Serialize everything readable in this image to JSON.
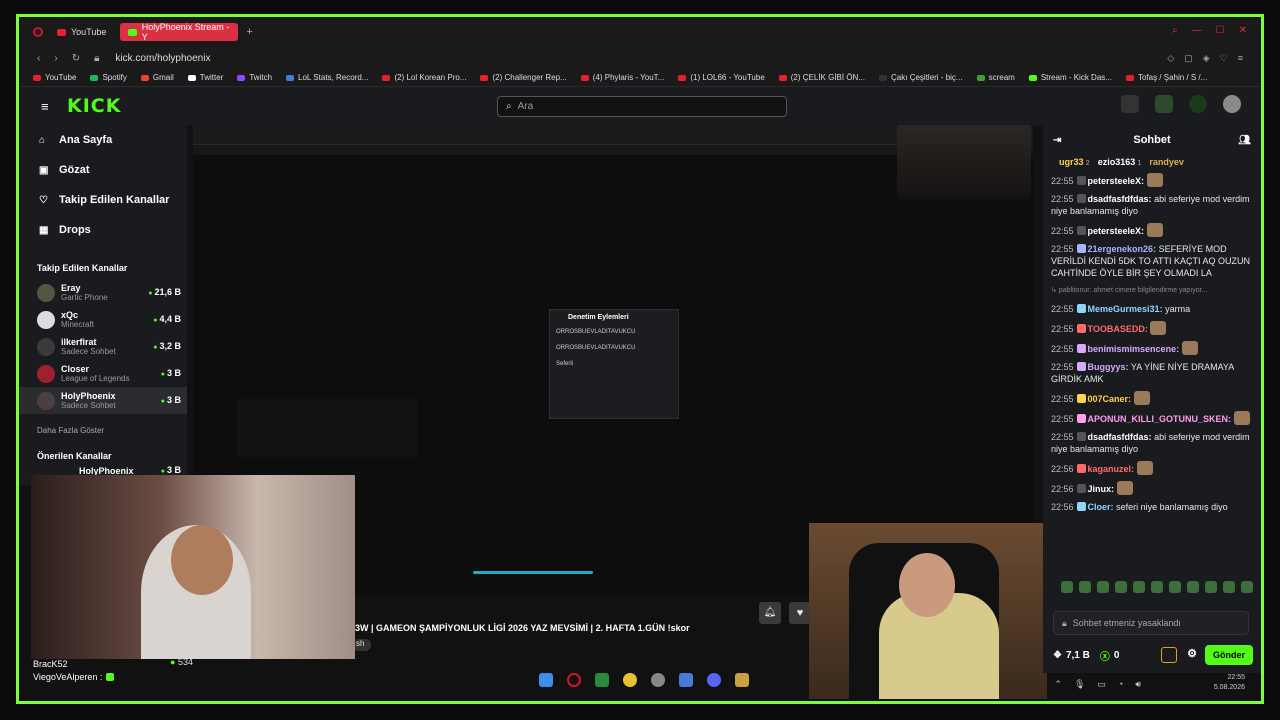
{
  "browser": {
    "tabs": [
      {
        "label": "YouTube"
      },
      {
        "label": "HolyPhoenix Stream - Y"
      }
    ],
    "url": "kick.com/holyphoenix",
    "bookmarks": [
      "YouTube",
      "Spotify",
      "Gmail",
      "Twitter",
      "Twitch",
      "LoL Stats, Record...",
      "(2) Lol Korean Pro...",
      "(2) Challenger Rep...",
      "(4) Phylaris - YouT...",
      "(1) LOL66 - YouTube",
      "(2) ÇELİK GİBİ ÖN...",
      "Çakı Çeşitleri - biç...",
      "scream",
      "Stream - Kick Das...",
      "Tofaş / Şahin / S /..."
    ]
  },
  "header": {
    "logo": "KICK",
    "search_placeholder": "Ara"
  },
  "sidebar": {
    "nav": [
      {
        "label": "Ana Sayfa",
        "icon": "home-icon"
      },
      {
        "label": "Gözat",
        "icon": "browse-icon"
      },
      {
        "label": "Takip Edilen Kanallar",
        "icon": "heart-icon"
      },
      {
        "label": "Drops",
        "icon": "drops-icon"
      }
    ],
    "followed_title": "Takip Edilen Kanallar",
    "channels": [
      {
        "name": "Eray",
        "game": "Gartic Phone",
        "viewers": "21,6 B"
      },
      {
        "name": "xQc",
        "game": "Minecraft",
        "viewers": "4,4 B"
      },
      {
        "name": "ilkerfirat",
        "game": "Sadece Sohbet",
        "viewers": "3,2 B"
      },
      {
        "name": "Closer",
        "game": "League of Legends",
        "viewers": "3 B"
      },
      {
        "name": "HolyPhoenix",
        "game": "Sadece Sohbet",
        "viewers": "3 B"
      }
    ],
    "show_more": "Daha Fazla Göster",
    "recommended_title": "Önerilen Kanallar",
    "recommended": [
      {
        "name": "HolyPhoenix",
        "viewers": "3 B"
      }
    ]
  },
  "modpanel": {
    "title": "Denetim Eylemleri",
    "rows": [
      "ORROSBUEVLADITAVUKCU",
      "ORROSBUEVLADITAVUKCU",
      "Seferli"
    ]
  },
  "stream": {
    "title": "3W | GAMEON ŞAMPİYONLUK LİGİ 2026 YAZ MEVSİMİ | 2. HAFTA 1.GÜN !skor",
    "tag": "sh"
  },
  "overlay_chat": {
    "lines": [
      {
        "user": "BracK52"
      },
      {
        "user": "ViegoVeAlperen :"
      }
    ],
    "viewer_count": "534"
  },
  "chat": {
    "title": "Sohbet",
    "gifters": [
      {
        "name": "ugr33",
        "n": "2"
      },
      {
        "name": "ezio3163",
        "n": "1"
      },
      {
        "name": "randyev",
        "n": ""
      }
    ],
    "messages": [
      {
        "time": "22:55",
        "user": "petersteeleX:",
        "text": "",
        "color": "#ffffff"
      },
      {
        "time": "22:55",
        "user": "dsadfasfdfdas:",
        "text": "abi seferiye mod verdim niye banlamamış diyo",
        "color": "#ffffff"
      },
      {
        "time": "22:55",
        "user": "petersteeleX:",
        "text": "",
        "color": "#ffffff"
      },
      {
        "time": "22:55",
        "user": "21ergenekon26:",
        "text": "SEFERİYE MOD VERİLDİ KENDİ 5DK TO ATTI KAÇTI AQ OUZUN CAHTİNDE ÖYLE BİR ŞEY OLMADI LA",
        "color": "#a8b4ff"
      },
      {
        "time": "",
        "user": "",
        "text": "↳ pablitonur: ahmet cimere bilgilendirme yapıyor...",
        "color": "#888888"
      },
      {
        "time": "22:55",
        "user": "MemeGurmesi31:",
        "text": "yarma",
        "color": "#8fd6ff"
      },
      {
        "time": "22:55",
        "user": "TOOBASEDD:",
        "text": "",
        "color": "#ff6b6b"
      },
      {
        "time": "22:55",
        "user": "benimismimsencene:",
        "text": "",
        "color": "#d6a8ff"
      },
      {
        "time": "22:55",
        "user": "Buggyys:",
        "text": "YA YİNE NİYE DRAMAYA GİRDİK AMK",
        "color": "#d6a8ff"
      },
      {
        "time": "22:55",
        "user": "007Caner:",
        "text": "",
        "color": "#ffd24a"
      },
      {
        "time": "22:55",
        "user": "APONUN_KILLI_GOTUNU_SKEN:",
        "text": "",
        "color": "#ff9cf0"
      },
      {
        "time": "22:55",
        "user": "dsadfasfdfdas:",
        "text": "abi seferiye mod verdim niye banlamamış diyo",
        "color": "#ffffff"
      },
      {
        "time": "22:56",
        "user": "kaganuzel:",
        "text": "",
        "color": "#ff6b6b"
      },
      {
        "time": "22:56",
        "user": "Jinux:",
        "text": "",
        "color": "#ffffff"
      },
      {
        "time": "22:56",
        "user": "Cloer:",
        "text": "seferi niye banlamamış diyo",
        "color": "#8fd6ff"
      }
    ],
    "input_placeholder": "Sohbet etmeniz yasaklandı",
    "points": "7,1 B",
    "count": "0",
    "send_label": "Gönder"
  },
  "clock": {
    "time": "22:55",
    "date": "5.08.2026"
  },
  "colors": {
    "accent": "#53fc18",
    "frame": "#7cff3a",
    "opera_red": "#d2142c"
  }
}
